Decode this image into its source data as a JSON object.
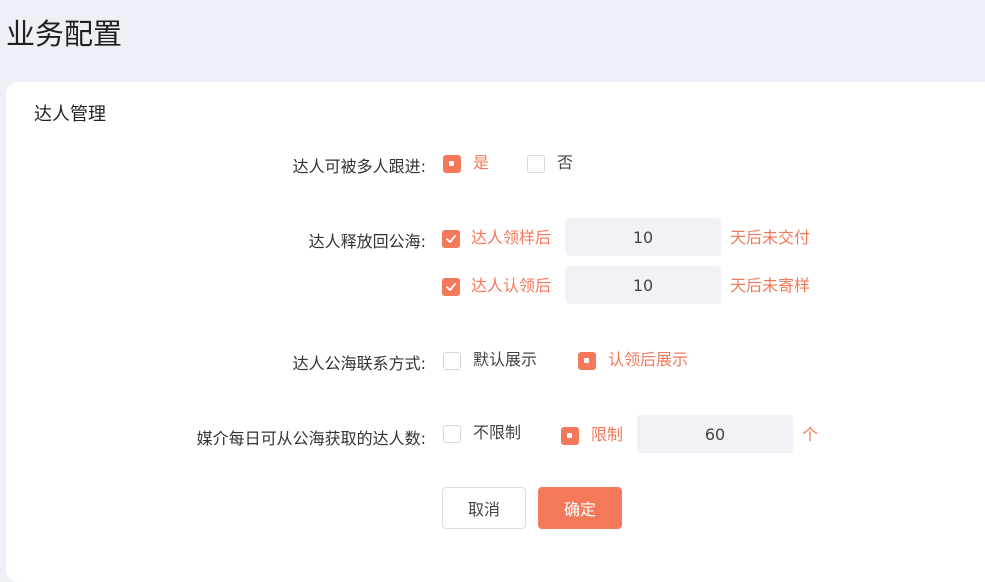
{
  "page": {
    "title": "业务配置"
  },
  "section": {
    "title": "达人管理"
  },
  "multi_follow": {
    "label": "达人可被多人跟进:",
    "options": [
      {
        "label": "是",
        "selected": true
      },
      {
        "label": "否",
        "selected": false
      }
    ]
  },
  "release": {
    "label": "达人释放回公海:",
    "rules": [
      {
        "label": "达人领样后",
        "checked": true,
        "value": "10",
        "suffix": "天后未交付"
      },
      {
        "label": "达人认领后",
        "checked": true,
        "value": "10",
        "suffix": "天后未寄样"
      }
    ]
  },
  "contact": {
    "label": "达人公海联系方式:",
    "options": [
      {
        "label": "默认展示",
        "selected": false
      },
      {
        "label": "认领后展示",
        "selected": true
      }
    ]
  },
  "daily_limit": {
    "label": "媒介每日可从公海获取的达人数:",
    "options": [
      {
        "label": "不限制",
        "selected": false
      },
      {
        "label": "限制",
        "selected": true
      }
    ],
    "value": "60",
    "suffix": "个"
  },
  "actions": {
    "cancel_label": "取消",
    "confirm_label": "确定"
  },
  "colors": {
    "accent": "#f4795a",
    "background": "#eef0f7",
    "input_bg": "#f1f2f5"
  },
  "icons": {
    "check": "check-icon",
    "radio_dot": "radio-dot-icon"
  }
}
